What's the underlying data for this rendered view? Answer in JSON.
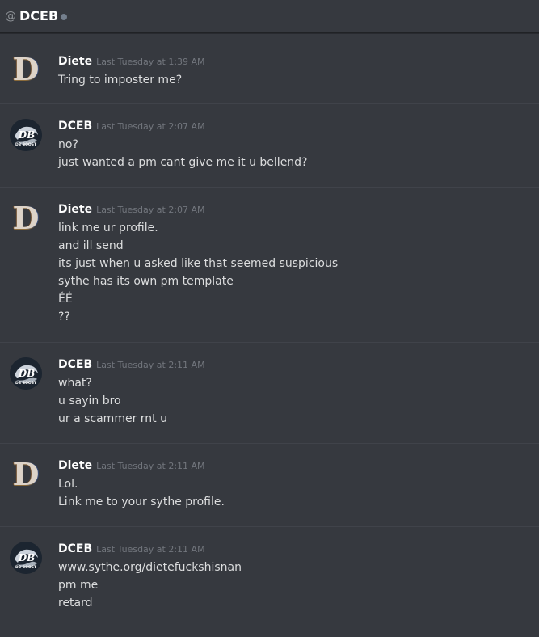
{
  "header": {
    "at_symbol": "@",
    "channel": "DCEB"
  },
  "messages": [
    {
      "author": "Diete",
      "timestamp": "Last Tuesday at 1:39 AM",
      "lines": [
        "Tring to imposter me?"
      ]
    },
    {
      "author": "DCEB",
      "timestamp": "Last Tuesday at 2:07 AM",
      "lines": [
        "no?",
        "just wanted a pm cant give me it u bellend?"
      ]
    },
    {
      "author": "Diete",
      "timestamp": "Last Tuesday at 2:07 AM",
      "lines": [
        "link me ur profile.",
        "and ill send",
        "its just when u asked like that seemed suspicious",
        "sythe has its own pm template",
        "ÉÉ",
        "??"
      ]
    },
    {
      "author": "DCEB",
      "timestamp": "Last Tuesday at 2:11 AM",
      "lines": [
        "what?",
        "u sayin bro",
        "ur a scammer rnt u"
      ]
    },
    {
      "author": "Diete",
      "timestamp": "Last Tuesday at 2:11 AM",
      "lines": [
        "Lol.",
        "Link me to your sythe profile."
      ]
    },
    {
      "author": "DCEB",
      "timestamp": "Last Tuesday at 2:11 AM",
      "lines": [
        "www.sythe.org/dietefuckshisnan",
        "pm me",
        "retard"
      ]
    }
  ],
  "avatars": {
    "diete_letter": "D",
    "dceb_logo_text": "DB",
    "dceb_logo_sub": "DB BOOST"
  },
  "colors": {
    "background": "#36393f",
    "username": "#ffffff",
    "timestamp": "#72767d",
    "text": "#dcddde"
  }
}
